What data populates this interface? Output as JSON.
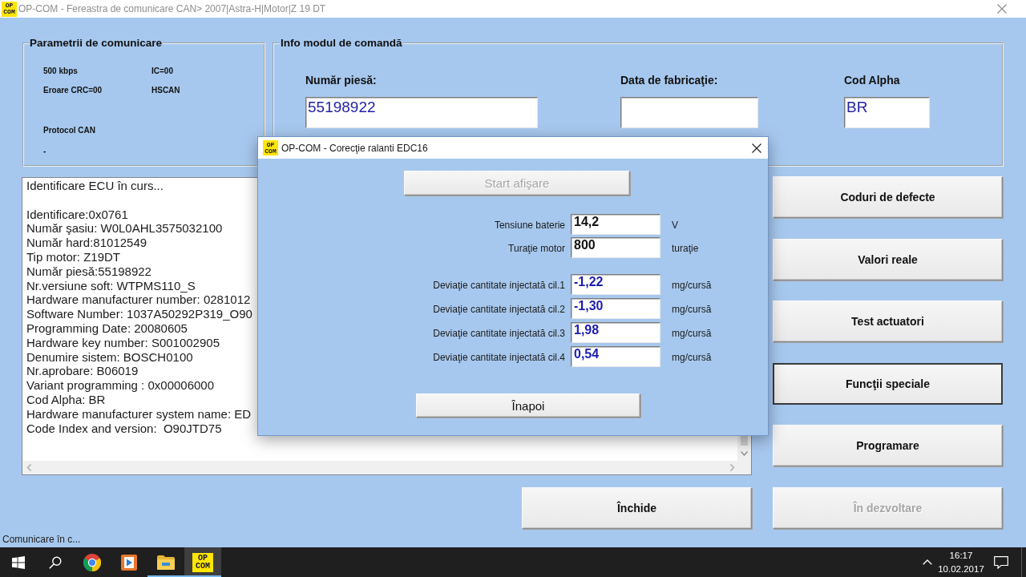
{
  "window": {
    "icon_lines": [
      "OP",
      "COM"
    ],
    "title": "OP-COM - Fereastra de comunicare CAN> 2007|Astra-H|Motor|Z 19 DT"
  },
  "comm_params": {
    "title": "Parametrii de comunicare",
    "speed": "500 kbps",
    "ic": "IC=00",
    "crc": "Eroare CRC=00",
    "bus": "HSCAN",
    "protocol": "Protocol CAN",
    "protocol_value": "-"
  },
  "module_info": {
    "title": "Info modul de comandă",
    "fields": [
      {
        "label": "Număr piesă:",
        "value": "55198922"
      },
      {
        "label": "Data de fabricaţie:"
      },
      {
        "label": "Cod Alpha",
        "value": "BR"
      }
    ]
  },
  "log": {
    "header": "Identificare ECU în curs...",
    "lines": [
      "Identificare:0x0761",
      "Număr şasiu: W0L0AHL3575032100",
      "Număr hard:81012549",
      "Tip motor: Z19DT",
      "Număr piesă:55198922",
      "Nr.versiune soft: WTPMS110_S",
      "Hardware manufacturer number: 0281012",
      "Software Number: 1037A50292P319_O90",
      "Programming Date: 20080605",
      "Hardware key number: S001002905",
      "Denumire sistem: BOSCH0100",
      "Nr.aprobare: B06019",
      "Variant programming : 0x00006000",
      "Cod Alpha: BR",
      "Hardware manufacturer system name: ED",
      "Code Index and version:  O90JTD75"
    ]
  },
  "side_buttons": [
    {
      "label": "Coduri de defecte",
      "focused": false
    },
    {
      "label": "Valori reale",
      "focused": false
    },
    {
      "label": "Test actuatori",
      "focused": false
    },
    {
      "label": "Funcţii speciale",
      "focused": true
    },
    {
      "label": "Programare",
      "focused": false
    }
  ],
  "bottom_buttons": [
    {
      "label": "Închide",
      "disabled": false
    },
    {
      "label": "În dezvoltare",
      "disabled": true
    }
  ],
  "status": "Comunicare în c...",
  "dialog": {
    "icon_lines": [
      "OP",
      "COM"
    ],
    "title": "OP-COM - Corecţie ralanti EDC16",
    "start_button": {
      "label": "Start afişare",
      "disabled": true
    },
    "readings": [
      {
        "label": "Tensiune baterie",
        "value": "14,2",
        "unit": "V"
      },
      {
        "label": "Turaţie motor",
        "value": "800",
        "unit": "turaţie"
      }
    ],
    "deviations": [
      {
        "label": "Deviaţie cantitate injectată cil.1",
        "value": "-1,22",
        "unit": "mg/cursă"
      },
      {
        "label": "Deviaţie cantitate injectată cil.2",
        "value": "-1,30",
        "unit": "mg/cursă"
      },
      {
        "label": "Deviaţie cantitate injectată cil.3",
        "value": "1,98",
        "unit": "mg/cursă"
      },
      {
        "label": "Deviaţie cantitate injectată cil.4",
        "value": "0,54",
        "unit": "mg/cursă"
      }
    ],
    "back_button": {
      "label": "Înapoi"
    }
  },
  "taskbar": {
    "apps": [
      {
        "kind": "browser",
        "running": false,
        "active": false
      },
      {
        "kind": "player",
        "running": false,
        "active": false
      },
      {
        "kind": "files",
        "running": true,
        "active": false
      },
      {
        "kind": "app",
        "icon_lines": [
          "OP",
          "COM"
        ],
        "running": true,
        "active": true
      }
    ],
    "clock": {
      "time": "16:17",
      "date": "10.02.2017"
    }
  }
}
